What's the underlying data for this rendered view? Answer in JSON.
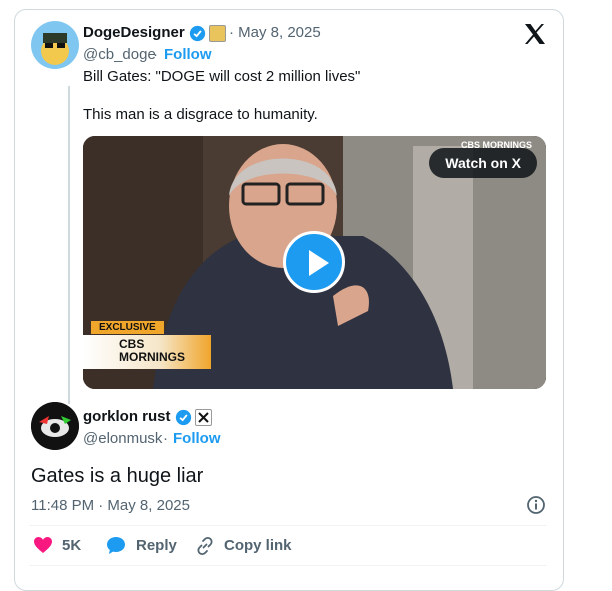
{
  "quoted": {
    "name": "DogeDesigner",
    "handle": "@cb_doge",
    "follow": "Follow",
    "date": "· May 8, 2025",
    "text1": "Bill Gates: \"DOGE will cost 2 million lives\"",
    "text2": "This man is a disgrace to humanity.",
    "video": {
      "watch_label": "Watch on X",
      "badge_top": "EXCLUSIVE",
      "badge_cbs": "CBS",
      "badge_mornings": "MORNINGS",
      "watermark": "CBS MORNINGS"
    }
  },
  "reply": {
    "name": "gorklon rust",
    "handle": "@elonmusk",
    "follow": "Follow",
    "text": "Gates is a huge liar",
    "timestamp": "11:48 PM · May 8, 2025"
  },
  "actions": {
    "likes": "5K",
    "reply": "Reply",
    "copy": "Copy link"
  },
  "colors": {
    "accent": "#1d9bf0",
    "like": "#f91880",
    "muted": "#536471"
  }
}
